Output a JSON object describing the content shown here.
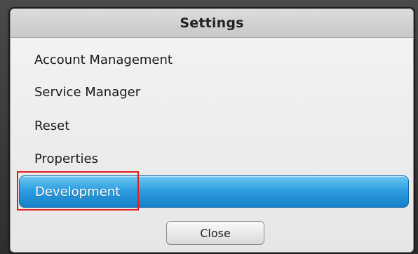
{
  "dialog": {
    "title": "Settings"
  },
  "menu": {
    "items": [
      {
        "label": "Account Management",
        "selected": false
      },
      {
        "label": "Service Manager",
        "selected": false
      },
      {
        "label": "Reset",
        "selected": false
      },
      {
        "label": "Properties",
        "selected": false
      },
      {
        "label": "Development",
        "selected": true
      }
    ]
  },
  "footer": {
    "close_label": "Close"
  },
  "colors": {
    "selection_accent": "#2f9ee0",
    "annotation_outline": "#e02020"
  }
}
